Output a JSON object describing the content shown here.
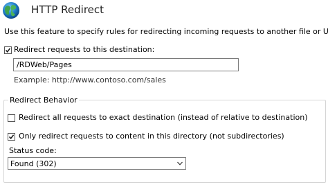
{
  "header": {
    "title": "HTTP Redirect",
    "icon": "globe-icon"
  },
  "description": "Use this feature to specify rules for redirecting incoming requests to another file or URL.",
  "redirect_enabled": {
    "label": "Redirect requests to this destination:",
    "checked": true
  },
  "destination": {
    "value": "/RDWeb/Pages",
    "example": "Example: http://www.contoso.com/sales"
  },
  "redirect_behavior": {
    "title": "Redirect Behavior",
    "exact_destination": {
      "label": "Redirect all requests to exact destination (instead of relative to destination)",
      "checked": false
    },
    "only_this_directory": {
      "label": "Only redirect requests to content in this directory (not subdirectories)",
      "checked": true
    },
    "status_code": {
      "label": "Status code:",
      "selected": "Found (302)"
    }
  }
}
